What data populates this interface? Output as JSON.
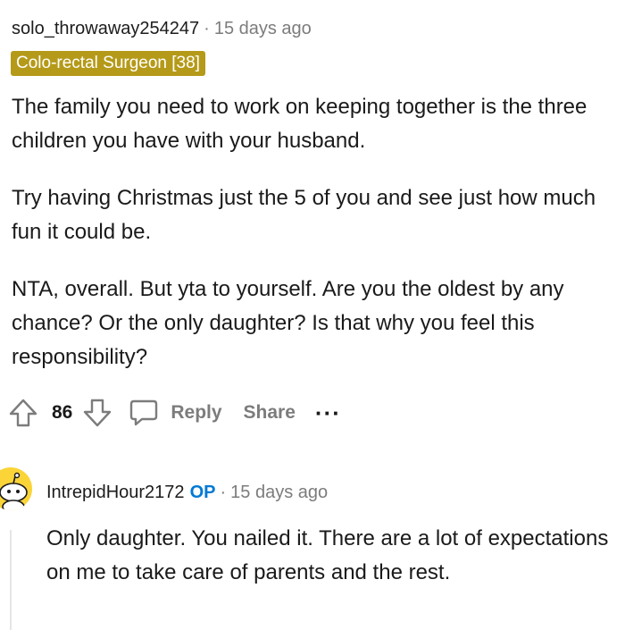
{
  "comment": {
    "username": "solo_throwaway254247",
    "separator": "·",
    "timestamp": "15 days ago",
    "flair": "Colo-rectal Surgeon [38]",
    "paragraphs": [
      "The family you need to work on keeping together is the three children you have with your husband.",
      "Try having Christmas just the 5 of you and see just how much fun it could be.",
      "NTA, overall. But yta to yourself. Are you the oldest by any chance? Or the only daughter? Is that why you feel this responsibility?"
    ],
    "actions": {
      "upvote_icon": "upvote-arrow-icon",
      "score": "86",
      "downvote_icon": "downvote-arrow-icon",
      "reply_icon": "speech-bubble-icon",
      "reply_label": "Reply",
      "share_label": "Share",
      "more_label": "···"
    }
  },
  "reply": {
    "avatar_icon": "snoo-avatar-icon",
    "username": "IntrepidHour2172",
    "op_badge": "OP",
    "separator": "·",
    "timestamp": "15 days ago",
    "text": "Only daughter. You nailed it. There are a lot of expectations on me to take care of parents and the rest."
  },
  "colors": {
    "flair_bg": "#b59a19",
    "op_blue": "#0079d3",
    "muted": "#7c7c7c",
    "avatar_bg": "#fbd437"
  }
}
